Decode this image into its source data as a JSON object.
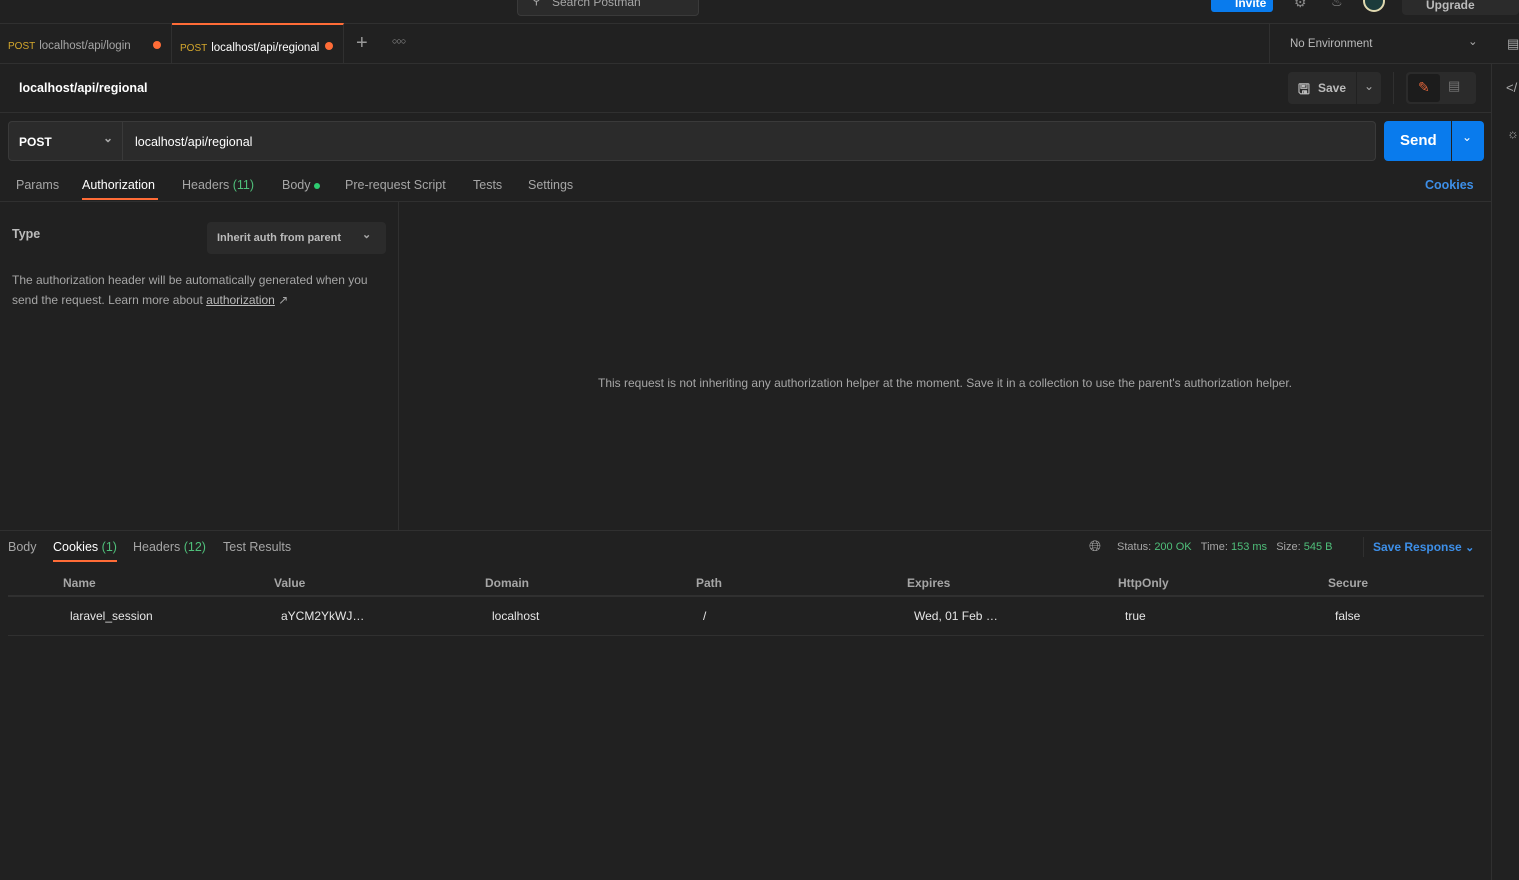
{
  "topbar": {
    "search_placeholder": "Search Postman",
    "invite_label": "Invite",
    "upgrade_label": "Upgrade"
  },
  "tabs": [
    {
      "method": "POST",
      "url": "localhost/api/login",
      "unsaved": true
    },
    {
      "method": "POST",
      "url": "localhost/api/regional",
      "unsaved": true,
      "active": true
    }
  ],
  "environment": {
    "selected": "No Environment"
  },
  "request": {
    "title": "localhost/api/regional",
    "save_label": "Save",
    "method": "POST",
    "url": "localhost/api/regional",
    "send_label": "Send"
  },
  "request_tabs": {
    "params": "Params",
    "authorization": "Authorization",
    "headers": "Headers",
    "headers_count": "(11)",
    "body": "Body",
    "prerequest": "Pre-request Script",
    "tests": "Tests",
    "settings": "Settings",
    "cookies": "Cookies"
  },
  "auth": {
    "type_label": "Type",
    "type_value": "Inherit auth from parent",
    "description": "The authorization header will be automatically generated when you send the request. Learn more about",
    "link": "authorization",
    "helper_message": "This request is not inheriting any authorization helper at the moment. Save it in a collection to use the parent's authorization helper."
  },
  "response": {
    "tabs": {
      "body": "Body",
      "cookies": "Cookies",
      "cookies_count": "(1)",
      "headers": "Headers",
      "headers_count": "(12)",
      "test_results": "Test Results"
    },
    "status_label": "Status:",
    "status": "200 OK",
    "time_label": "Time:",
    "time": "153 ms",
    "size_label": "Size:",
    "size": "545 B",
    "save_response": "Save Response",
    "cookie_columns": [
      "Name",
      "Value",
      "Domain",
      "Path",
      "Expires",
      "HttpOnly",
      "Secure"
    ],
    "cookies": [
      [
        "laravel_session",
        "aYCM2YkWJ…",
        "localhost",
        "/",
        "Wed, 01 Feb …",
        "true",
        "false"
      ]
    ]
  },
  "colors": {
    "accent": "#ff6c37",
    "primary": "#097bed",
    "success": "#4fbf7a",
    "link": "#3d8fe8"
  }
}
